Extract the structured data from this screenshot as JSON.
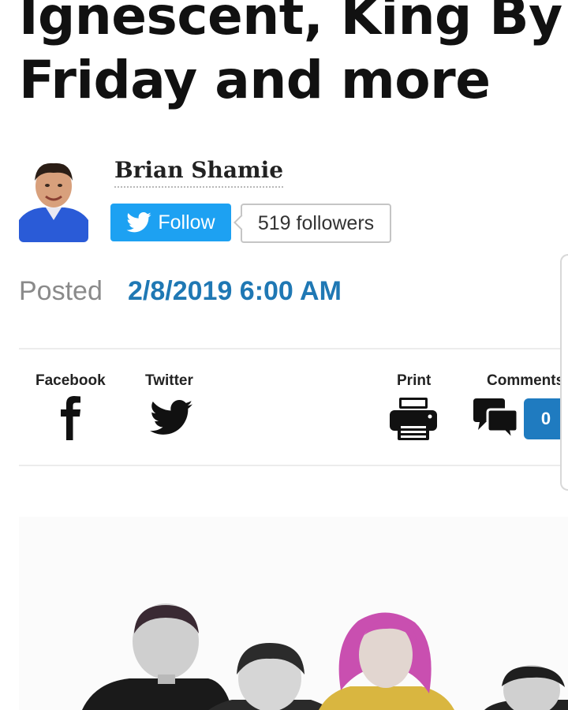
{
  "article": {
    "headline_line1": "Ignescent, King By",
    "headline_line2": "Friday and more"
  },
  "author": {
    "name": "Brian Shamie",
    "follow_label": "Follow",
    "followers_text": "519 followers"
  },
  "meta": {
    "posted_label": "Posted",
    "posted_date": "2/8/2019 6:00 AM"
  },
  "share": {
    "facebook_label": "Facebook",
    "twitter_label": "Twitter",
    "print_label": "Print",
    "comments_label": "Comments",
    "comments_count": "0"
  },
  "icons": {
    "twitter": "twitter-bird-icon",
    "facebook": "facebook-f-icon",
    "print": "printer-icon",
    "comments": "speech-bubbles-icon"
  },
  "colors": {
    "follow_button": "#1da1f2",
    "date": "#1f78b4",
    "comment_badge": "#1f7bc0",
    "pink_hair": "#c94fb0",
    "dark_hair": "#3a2a33"
  }
}
